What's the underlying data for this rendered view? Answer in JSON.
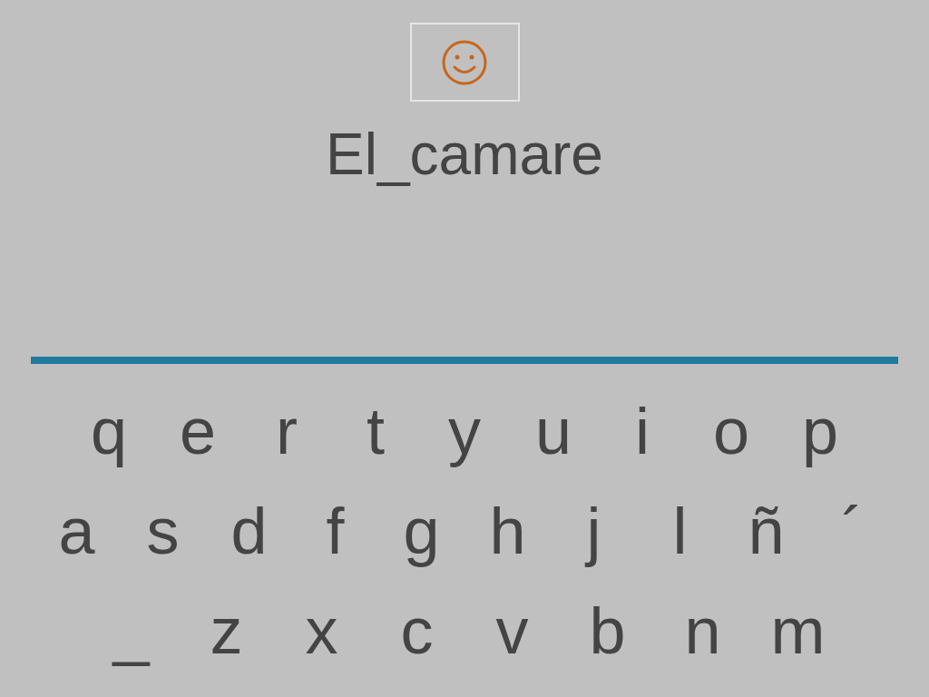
{
  "word": "El_camare",
  "keyboard": {
    "rows": [
      [
        "q",
        "e",
        "r",
        "t",
        "y",
        "u",
        "i",
        "o",
        "p"
      ],
      [
        "a",
        "s",
        "d",
        "f",
        "g",
        "h",
        "j",
        "l",
        "ñ",
        "´"
      ],
      [
        "_",
        "z",
        "x",
        "c",
        "v",
        "b",
        "n",
        "m"
      ]
    ]
  }
}
